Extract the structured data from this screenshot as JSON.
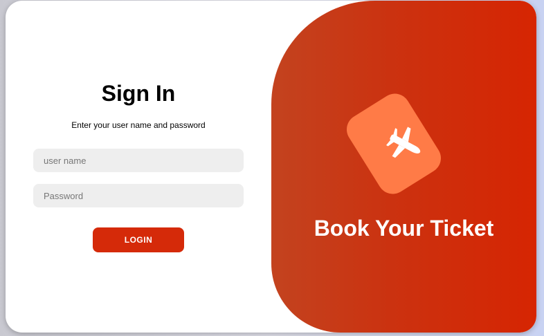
{
  "login": {
    "title": "Sign In",
    "subtitle": "Enter your user name and password",
    "username_placeholder": "user name",
    "password_placeholder": "Password",
    "login_label": "LOGIN"
  },
  "promo": {
    "title": "Book Your Ticket",
    "icon": "airplane-ticket-icon"
  },
  "colors": {
    "accent": "#d52a09",
    "promo_gradient_start": "#c3431f",
    "promo_gradient_end": "#d62502",
    "ticket": "#ff7b47",
    "input_bg": "#eeeeee"
  }
}
